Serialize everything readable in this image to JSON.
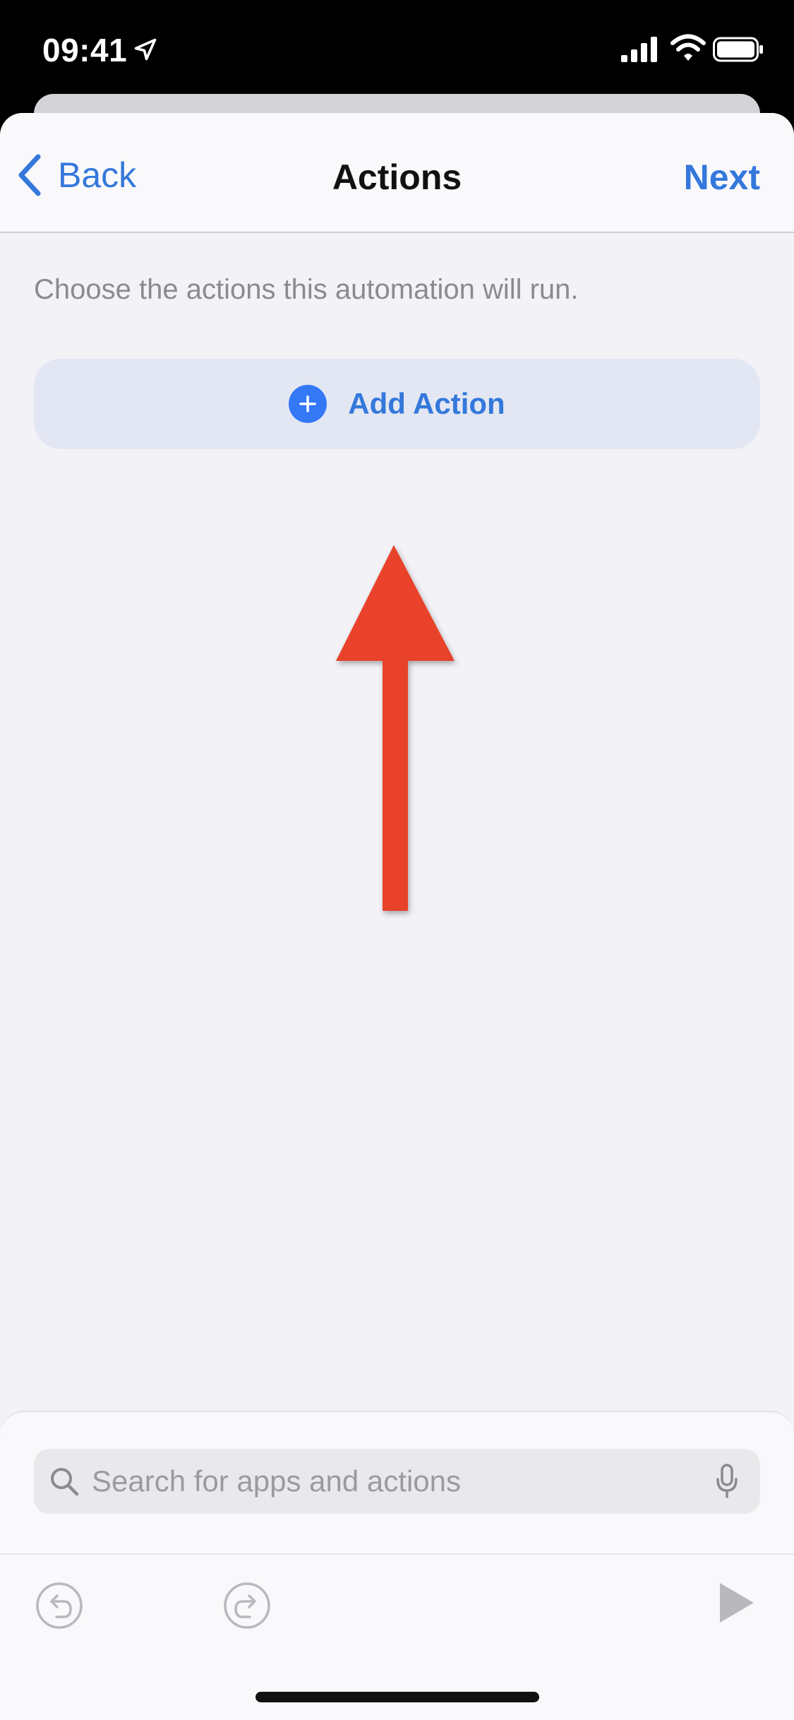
{
  "status_bar": {
    "time": "09:41"
  },
  "nav": {
    "back_label": "Back",
    "title": "Actions",
    "next_label": "Next"
  },
  "content": {
    "subtitle": "Choose the actions this automation will run.",
    "add_action_label": "Add Action"
  },
  "search": {
    "placeholder": "Search for apps and actions",
    "value": ""
  },
  "icons": {
    "status": [
      "location-arrow-icon",
      "cellular-signal-icon",
      "wifi-icon",
      "battery-icon"
    ],
    "nav": [
      "chevron-left-icon"
    ],
    "content": [
      "plus-circle-icon",
      "red-arrow-annotation"
    ],
    "toolbar": [
      "search-icon",
      "microphone-icon",
      "undo-icon",
      "redo-icon",
      "play-icon"
    ]
  },
  "colors": {
    "accent": "#3478db",
    "add_button_bg": "#e2e7f3",
    "annotation_arrow": "#e8432b",
    "sheet_bg": "#f2f2f7"
  }
}
